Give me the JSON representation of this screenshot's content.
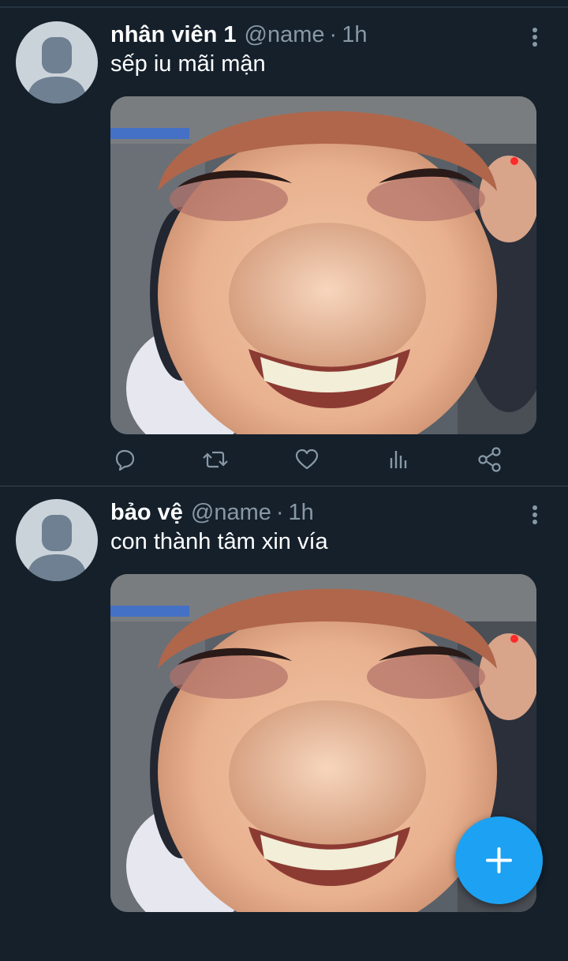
{
  "tweets": [
    {
      "display_name": "nhân viên 1",
      "handle": "@name",
      "separator": "·",
      "time": "1h",
      "text": "sếp iu mãi mận",
      "media_icon": "photo-image"
    },
    {
      "display_name": "bảo vệ",
      "handle": "@name",
      "separator": "·",
      "time": "1h",
      "text": "con thành tâm xin vía",
      "media_icon": "photo-image"
    }
  ],
  "action_icons": [
    "reply-icon",
    "retweet-icon",
    "like-icon",
    "analytics-icon",
    "share-icon"
  ],
  "fab": {
    "icon": "plus-icon",
    "color": "#1da1f2"
  },
  "colors": {
    "background": "#15202b",
    "muted_text": "#8899a6",
    "divider": "#38444d",
    "accent": "#1da1f2"
  }
}
